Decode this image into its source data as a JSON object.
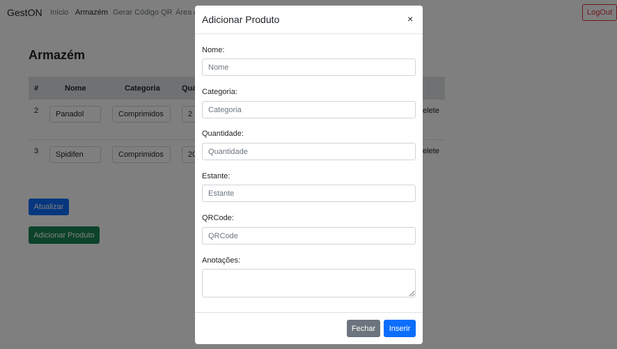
{
  "nav": {
    "brand": "GestON",
    "links": [
      "Início",
      "Armazém",
      "Gerar Código QR",
      "Área A"
    ],
    "logout": "LogOut"
  },
  "page": {
    "title": "Armazém",
    "columns": [
      "#",
      "Nome",
      "Categoria",
      "Qua"
    ],
    "rows": [
      {
        "num": "2",
        "nome": "Panadol",
        "categoria": "Comprimidos",
        "quantidade": "2",
        "delete": "elete"
      },
      {
        "num": "3",
        "nome": "Spidifen",
        "categoria": "Comprimidos",
        "quantidade": "20",
        "delete": "elete"
      }
    ],
    "update_button": "Atualizar",
    "add_button": "Adicionar Produto"
  },
  "modal": {
    "title": "Adicionar Produto",
    "close": "×",
    "fields": [
      {
        "label": "Nome:",
        "placeholder": "Nome"
      },
      {
        "label": "Categoria:",
        "placeholder": "Categoria"
      },
      {
        "label": "Quantidade:",
        "placeholder": "Quantidade"
      },
      {
        "label": "Estante:",
        "placeholder": "Estante"
      },
      {
        "label": "QRCode:",
        "placeholder": "QRCode"
      }
    ],
    "notes_label": "Anotações:",
    "close_button": "Fechar",
    "insert_button": "Inserir"
  },
  "colors": {
    "primary": "#0d6efd",
    "success": "#198754",
    "secondary": "#6c757d",
    "danger": "#dc3545"
  }
}
